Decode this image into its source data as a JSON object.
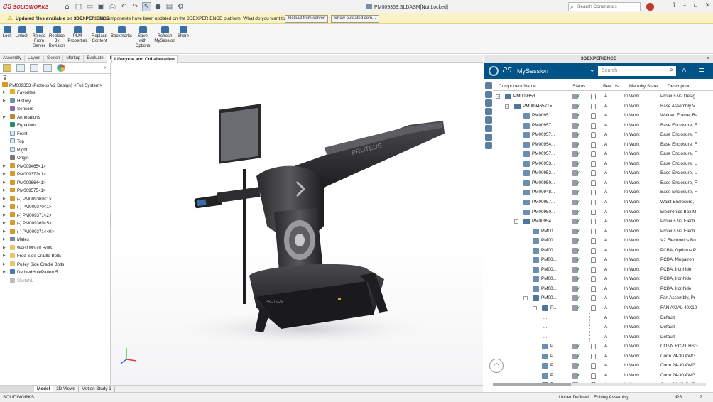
{
  "titlebar": {
    "app_name": "SOLIDWORKS",
    "document_title": "PM009353.SLDASM[Not Locked]",
    "search_placeholder": "Search Commands"
  },
  "notification": {
    "title": "Updated files available on 3DEXPERIENCE",
    "message": "11 components have been updated on the 3DEXPERIENCE platform. What do you want to do?",
    "reload_button": "Reload from server",
    "show_button": "Show outdated com..."
  },
  "ribbon": {
    "buttons": [
      {
        "label": "Lock"
      },
      {
        "label": "Unlock"
      },
      {
        "label": "Reload From Server"
      },
      {
        "label": "Replace By Revision"
      },
      {
        "label": "PLM Properties"
      },
      {
        "label": "Replace Content"
      },
      {
        "label": "Bookmarks"
      },
      {
        "label": "Save with Options"
      },
      {
        "label": "Refresh MySession"
      },
      {
        "label": "Share"
      }
    ]
  },
  "command_tabs": [
    "Assembly",
    "Layout",
    "Sketch",
    "Markup",
    "Evaluate",
    "Lifecycle and Collaboration"
  ],
  "feature_tree": {
    "root": "PM009353 (Proteus V2 Design) <Full System>",
    "items": [
      {
        "label": "Favorites",
        "icon": "star",
        "expand": true
      },
      {
        "label": "History",
        "icon": "history",
        "expand": true
      },
      {
        "label": "Sensors",
        "icon": "sensor",
        "expand": false
      },
      {
        "label": "Annotations",
        "icon": "annotation",
        "expand": true
      },
      {
        "label": "Equations",
        "icon": "equation",
        "expand": false
      },
      {
        "label": "Front",
        "icon": "plane",
        "expand": false
      },
      {
        "label": "Top",
        "icon": "plane",
        "expand": false
      },
      {
        "label": "Right",
        "icon": "plane",
        "expand": false
      },
      {
        "label": "Origin",
        "icon": "origin",
        "expand": false
      },
      {
        "label": "PM009465<1>",
        "icon": "assembly",
        "expand": true
      },
      {
        "label": "PM009372<1>",
        "icon": "assembly",
        "expand": true
      },
      {
        "label": "PM009664<1>",
        "icon": "assembly",
        "expand": true
      },
      {
        "label": "PM009575<1>",
        "icon": "assembly",
        "expand": true
      },
      {
        "label": "(-) PM009369<1>",
        "icon": "part",
        "expand": true
      },
      {
        "label": "(-) PM009370<1>",
        "icon": "part",
        "expand": true
      },
      {
        "label": "(-) PM009371<2>",
        "icon": "part",
        "expand": true
      },
      {
        "label": "(-) PM009369<5>",
        "icon": "part",
        "expand": true
      },
      {
        "label": "(-) PM009371<40>",
        "icon": "part",
        "expand": true
      },
      {
        "label": "Mates",
        "icon": "mates",
        "expand": true
      },
      {
        "label": "Waist Mount Bolts",
        "icon": "folder",
        "expand": true
      },
      {
        "label": "Free Side Cradle Bolts",
        "icon": "folder",
        "expand": true
      },
      {
        "label": "Pulley Side Cradle Bolts",
        "icon": "folder",
        "expand": true
      },
      {
        "label": "DerivedHolePattern5",
        "icon": "pattern",
        "expand": true
      },
      {
        "label": "Sketch1",
        "icon": "sketch",
        "expand": false,
        "dim": true
      }
    ]
  },
  "graphics": {
    "brand_text": "PROTEUS"
  },
  "experience_panel": {
    "header": "3DEXPERIENCE",
    "session_title": "MySession",
    "search_placeholder": "Search",
    "columns": [
      "Component Name",
      "Status",
      "Rev",
      "Is...",
      "Maturity State",
      "Description"
    ],
    "rows": [
      {
        "indent": 0,
        "twisty": "-",
        "name": "PM009353",
        "rev": "A",
        "state": "In Work",
        "desc": "Proteus V2 Desig",
        "asm": true
      },
      {
        "indent": 1,
        "twisty": "-",
        "name": "PM009465<1>",
        "rev": "A",
        "state": "In Work",
        "desc": "Base Assembly V",
        "asm": true
      },
      {
        "indent": 2,
        "twisty": "",
        "name": "PM00951...",
        "rev": "A",
        "state": "In Work",
        "desc": "Welded Frame, Ba"
      },
      {
        "indent": 2,
        "twisty": "",
        "name": "PM00957...",
        "rev": "A",
        "state": "In Work",
        "desc": "Base Enclosure, F"
      },
      {
        "indent": 2,
        "twisty": "",
        "name": "PM00957...",
        "rev": "A",
        "state": "In Work",
        "desc": "Base Enclosure, F"
      },
      {
        "indent": 2,
        "twisty": "",
        "name": "PM00954...",
        "rev": "A",
        "state": "In Work",
        "desc": "Base Enclosure, F"
      },
      {
        "indent": 2,
        "twisty": "",
        "name": "PM00957...",
        "rev": "A",
        "state": "In Work",
        "desc": "Base Enclosure, F"
      },
      {
        "indent": 2,
        "twisty": "",
        "name": "PM00953...",
        "rev": "A",
        "state": "In Work",
        "desc": "Base Enclosure, U"
      },
      {
        "indent": 2,
        "twisty": "",
        "name": "PM00953...",
        "rev": "A",
        "state": "In Work",
        "desc": "Base Enclosure, U"
      },
      {
        "indent": 2,
        "twisty": "",
        "name": "PM00950...",
        "rev": "A",
        "state": "In Work",
        "desc": "Base Enclosure, F"
      },
      {
        "indent": 2,
        "twisty": "",
        "name": "PM00948...",
        "rev": "A",
        "state": "In Work",
        "desc": "Base Enclosure, F"
      },
      {
        "indent": 2,
        "twisty": "",
        "name": "PM00957...",
        "rev": "A",
        "state": "In Work",
        "desc": "Waist Enclosure,"
      },
      {
        "indent": 2,
        "twisty": "",
        "name": "PM00950...",
        "rev": "A",
        "state": "In Work",
        "desc": "Electronics Box M"
      },
      {
        "indent": 2,
        "twisty": "-",
        "name": "PM00954...",
        "rev": "A",
        "state": "In Work",
        "desc": "Proteus V2 Electr",
        "asm": true
      },
      {
        "indent": 3,
        "twisty": "",
        "name": "PM00...",
        "rev": "A",
        "state": "In Work",
        "desc": "Proteus V2 Electr"
      },
      {
        "indent": 3,
        "twisty": "",
        "name": "PM00...",
        "rev": "A",
        "state": "In Work",
        "desc": "V2 Electronics Bo"
      },
      {
        "indent": 3,
        "twisty": "",
        "name": "PM00...",
        "rev": "A",
        "state": "In Work",
        "desc": "PCBA, Optimus P"
      },
      {
        "indent": 3,
        "twisty": "",
        "name": "PM00...",
        "rev": "A",
        "state": "In Work",
        "desc": "PCBA, Megatron"
      },
      {
        "indent": 3,
        "twisty": "",
        "name": "PM00...",
        "rev": "A",
        "state": "In Work",
        "desc": "PCBA, Ironhide"
      },
      {
        "indent": 3,
        "twisty": "",
        "name": "PM00...",
        "rev": "A",
        "state": "In Work",
        "desc": "PCBA, Ironhide"
      },
      {
        "indent": 3,
        "twisty": "",
        "name": "PM00...",
        "rev": "A",
        "state": "In Work",
        "desc": "PCBA, Ironhide"
      },
      {
        "indent": 3,
        "twisty": "-",
        "name": "PM00...",
        "rev": "A",
        "state": "In Work",
        "desc": "Fan Assembly, Pr",
        "asm": true
      },
      {
        "indent": 4,
        "twisty": "-",
        "name": "P...",
        "rev": "A",
        "state": "In Work",
        "desc": "FAN AXIAL 40X10",
        "asm": true
      },
      {
        "indent": 5,
        "twisty": "",
        "name": "...",
        "rev": "A",
        "state": "In Work",
        "desc": "Default",
        "sub": true
      },
      {
        "indent": 5,
        "twisty": "",
        "name": "...",
        "rev": "A",
        "state": "In Work",
        "desc": "Default",
        "sub": true
      },
      {
        "indent": 5,
        "twisty": "",
        "name": "...",
        "rev": "A",
        "state": "In Work",
        "desc": "Default",
        "sub": true
      },
      {
        "indent": 4,
        "twisty": "",
        "name": "P...",
        "rev": "A",
        "state": "In Work",
        "desc": "CONN RCPT HSG"
      },
      {
        "indent": 4,
        "twisty": "",
        "name": "P...",
        "rev": "A",
        "state": "In Work",
        "desc": "Conn 24-30 AWG"
      },
      {
        "indent": 4,
        "twisty": "",
        "name": "P...",
        "rev": "A",
        "state": "In Work",
        "desc": "Conn 24-30 AWG"
      },
      {
        "indent": 4,
        "twisty": "",
        "name": "P...",
        "rev": "A",
        "state": "In Work",
        "desc": "Conn 24-30 AWG"
      },
      {
        "indent": 4,
        "twisty": "",
        "name": "P...",
        "rev": "A",
        "state": "In Work",
        "desc": "Conn 24-30 AWG"
      }
    ]
  },
  "bottom_tabs": [
    "Model",
    "3D Views",
    "Motion Study 1"
  ],
  "status_bar": {
    "app": "SOLIDWORKS",
    "definition": "Under Defined",
    "mode": "Editing Assembly",
    "units": "IPS"
  },
  "colors": {
    "accent": "#005386",
    "brand": "#c0202a",
    "ok": "#1c9d3a",
    "warning_bg": "#fcf3c4"
  }
}
